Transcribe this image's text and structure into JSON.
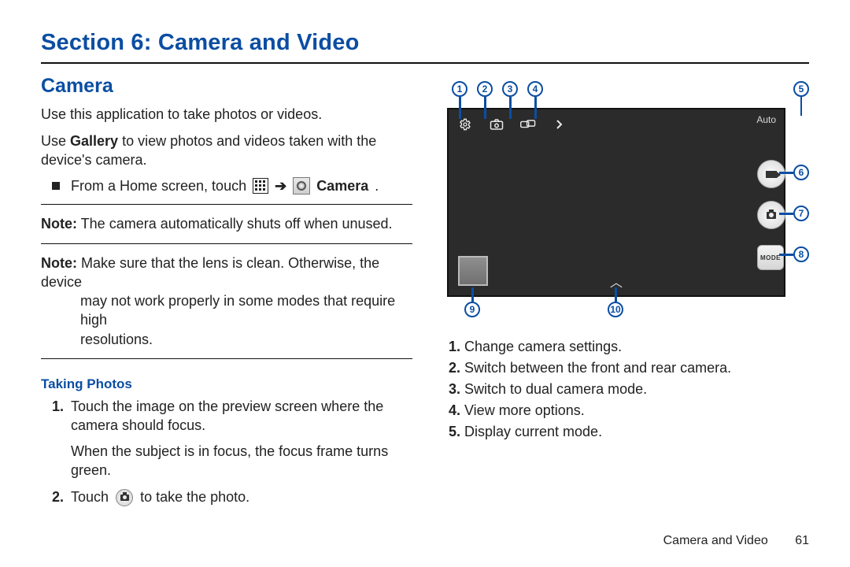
{
  "section_title": "Section 6: Camera and Video",
  "left": {
    "heading": "Camera",
    "para1": "Use this application to take photos or videos.",
    "para2_pre": "Use ",
    "para2_bold": "Gallery",
    "para2_post": " to view photos and videos taken with the device's camera.",
    "home_line_pre": "From a Home screen, touch ",
    "arrow": "➔",
    "home_line_bold": "Camera",
    "home_line_post": ".",
    "note1_label": "Note:",
    "note1_text": " The camera automatically shuts off when unused.",
    "note2_label": "Note:",
    "note2_line1": " Make sure that the lens is clean. Otherwise, the device",
    "note2_line2": "may not work properly in some modes that require high",
    "note2_line3": "resolutions.",
    "subhead": "Taking Photos",
    "step1a": "Touch the image on the preview screen where the camera should focus.",
    "step1b": "When the subject is in focus, the focus frame turns green.",
    "step2_pre": "Touch ",
    "step2_post": " to take the photo."
  },
  "right": {
    "callouts": {
      "c1": "1",
      "c2": "2",
      "c3": "3",
      "c4": "4",
      "c5": "5",
      "c6": "6",
      "c7": "7",
      "c8": "8",
      "c9": "9",
      "c10": "10"
    },
    "auto_label": "Auto",
    "mode_label": "MODE",
    "legend": {
      "i1": "Change camera settings.",
      "i2": "Switch between the front and rear camera.",
      "i3": "Switch to dual camera mode.",
      "i4": "View more options.",
      "i5": "Display current mode."
    }
  },
  "footer": {
    "chapter": "Camera and Video",
    "page": "61"
  }
}
